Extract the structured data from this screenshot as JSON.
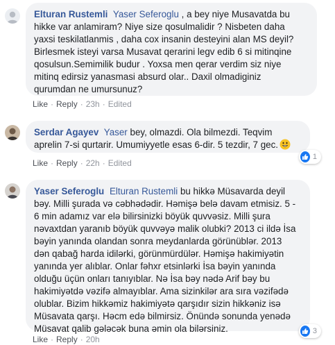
{
  "comments": [
    {
      "author": "Elturan Rustemli",
      "tag": "Yaser Seferoglu",
      "lines": [
        ", a bey niye Musavatda bu",
        "hikke var anlamiram? Niye size qosulmalidir ? Nisbeten daha",
        "yaxsi teskilatlanmis , daha cox insanin desteyini alan MS deyil?",
        "Birlesmek isteyi varsa Musavat qerarini legv edib 6 si mitinqine",
        "qosulsun.Semimilik budur . Yoxsa men qerar verdim siz niye",
        "mitinq edirsiz yanasmasi absurd olar.. Daxil olmadiginiz",
        "qurumdan ne umursunuz?"
      ],
      "like": "Like",
      "reply": "Reply",
      "time": "23h",
      "edited": "Edited"
    },
    {
      "author": "Serdar Agayev",
      "tag": "Yaser",
      "lines": [
        "bey, olmazdi. Ola bilmezdi. Teqvim",
        "aprelin 7-si qurtarir. Umumiyyetle esas 6-dir. 5 tezdir, 7 gec."
      ],
      "emoji": "grinning-face-emoji",
      "like": "Like",
      "reply": "Reply",
      "time": "22h",
      "edited": "Edited",
      "reaction_count": "1"
    },
    {
      "author": "Yaser Seferoglu",
      "tag": "Elturan Rustemli",
      "lines": [
        "bu hikkə Müsavarda deyil",
        "bəy. Milli şurada və cəbhədədir. Həmişə belə davam etmisiz. 5 -",
        "6 min adamız var elə bilirsinizki böyük quvvəsiz. Milli şura",
        "nəvaxtdan yaranıb böyük quvvəyə malik olubki? 2013 ci ildə İsa",
        "bəyin yanında olandan sonra meydanlarda görünüblər. 2013",
        "dən qabağ harda idilərki, görünmürdülər. Həmişə hakimiyətin",
        "yanında yer alıblar.  Onlar fəhxr etsinlərki İsa bəyin yanında",
        "olduğu üçün onları tanıyıblar. Nə İsa bəy nədə Arif bəy bu",
        "hakimiyətdə vəzifə almayıblar. Ama sizinkilər ara sıra vəzifədə",
        "olublar. Bizim hikkəmiz hakimiyətə qarşıdır sizin hikkəniz isə",
        "Müsavata qarşı. Həcm edə bilmirsiz. Önündə sonunda yenədə",
        "Müsavat qalib gələcək buna əmin ola bilərsiniz."
      ],
      "like": "Like",
      "reply": "Reply",
      "time": "20h",
      "reaction_count": "3"
    }
  ],
  "colors": {
    "link": "#365899",
    "bubble": "#f2f3f5",
    "meta": "#90949c",
    "like_badge": "#1877f2"
  }
}
